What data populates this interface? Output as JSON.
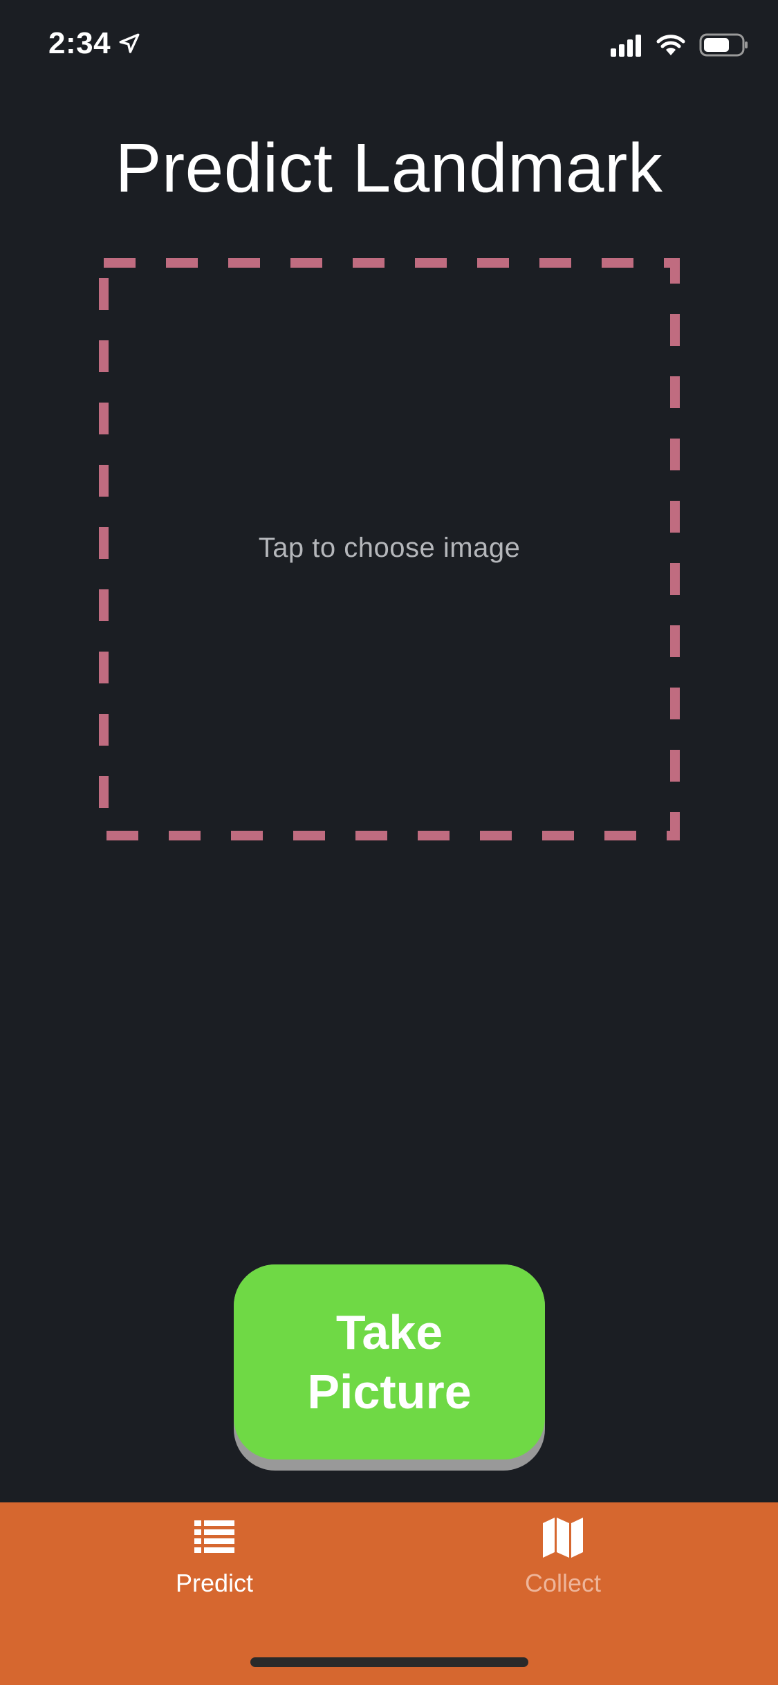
{
  "status_bar": {
    "time": "2:34",
    "icons": [
      "location-arrow-icon",
      "signal-icon",
      "wifi-icon",
      "battery-icon"
    ]
  },
  "title": "Predict Landmark",
  "image_picker": {
    "label": "Tap to choose image",
    "border_color": "#c06c80"
  },
  "take_picture_button": {
    "label": "Take Picture",
    "color": "#6fd945"
  },
  "tab_bar": {
    "background": "#d6672f",
    "tabs": [
      {
        "label": "Predict",
        "icon": "list-icon",
        "selected": true
      },
      {
        "label": "Collect",
        "icon": "map-icon",
        "selected": false
      }
    ]
  }
}
